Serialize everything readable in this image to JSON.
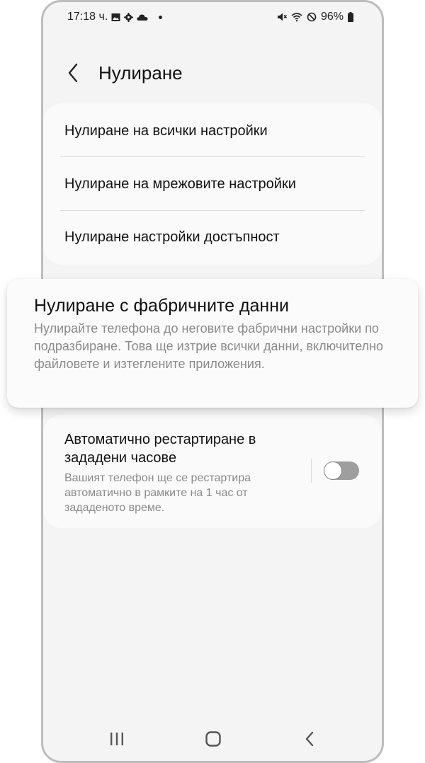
{
  "status_bar": {
    "time": "17:18 ч.",
    "battery": "96%",
    "left_icons": [
      "image-icon",
      "gear-icon",
      "cloud-icon",
      "dot-icon"
    ],
    "right_icons": [
      "mute-icon",
      "wifi-icon",
      "blocked-icon",
      "battery-icon"
    ]
  },
  "header": {
    "title": "Нулиране",
    "back_icon": "chevron-left-icon"
  },
  "reset_options": [
    {
      "label": "Нулиране на всички настройки"
    },
    {
      "label": "Нулиране на мрежовите настройки"
    },
    {
      "label": "Нулиране настройки достъпност"
    }
  ],
  "factory_reset": {
    "title": "Нулиране с фабричните данни",
    "description": "Нулирайте телефона до неговите фабрични настройки по подразбиране. Това ще изтрие всички данни, включително файловете и изтеглените приложения."
  },
  "auto_restart": {
    "title": "Автоматично рестартиране в зададени часове",
    "description": "Вашият телефон ще се рестартира автоматично в рамките на 1 час от зададеното време.",
    "enabled": false
  },
  "nav_bar": {
    "icons": [
      "recents-icon",
      "home-icon",
      "back-icon"
    ]
  },
  "colors": {
    "screen_bg": "#f4f4f4",
    "card_bg": "#fafafa",
    "secondary_text": "#8a8a8a",
    "toggle_off": "#9e9e9e"
  }
}
